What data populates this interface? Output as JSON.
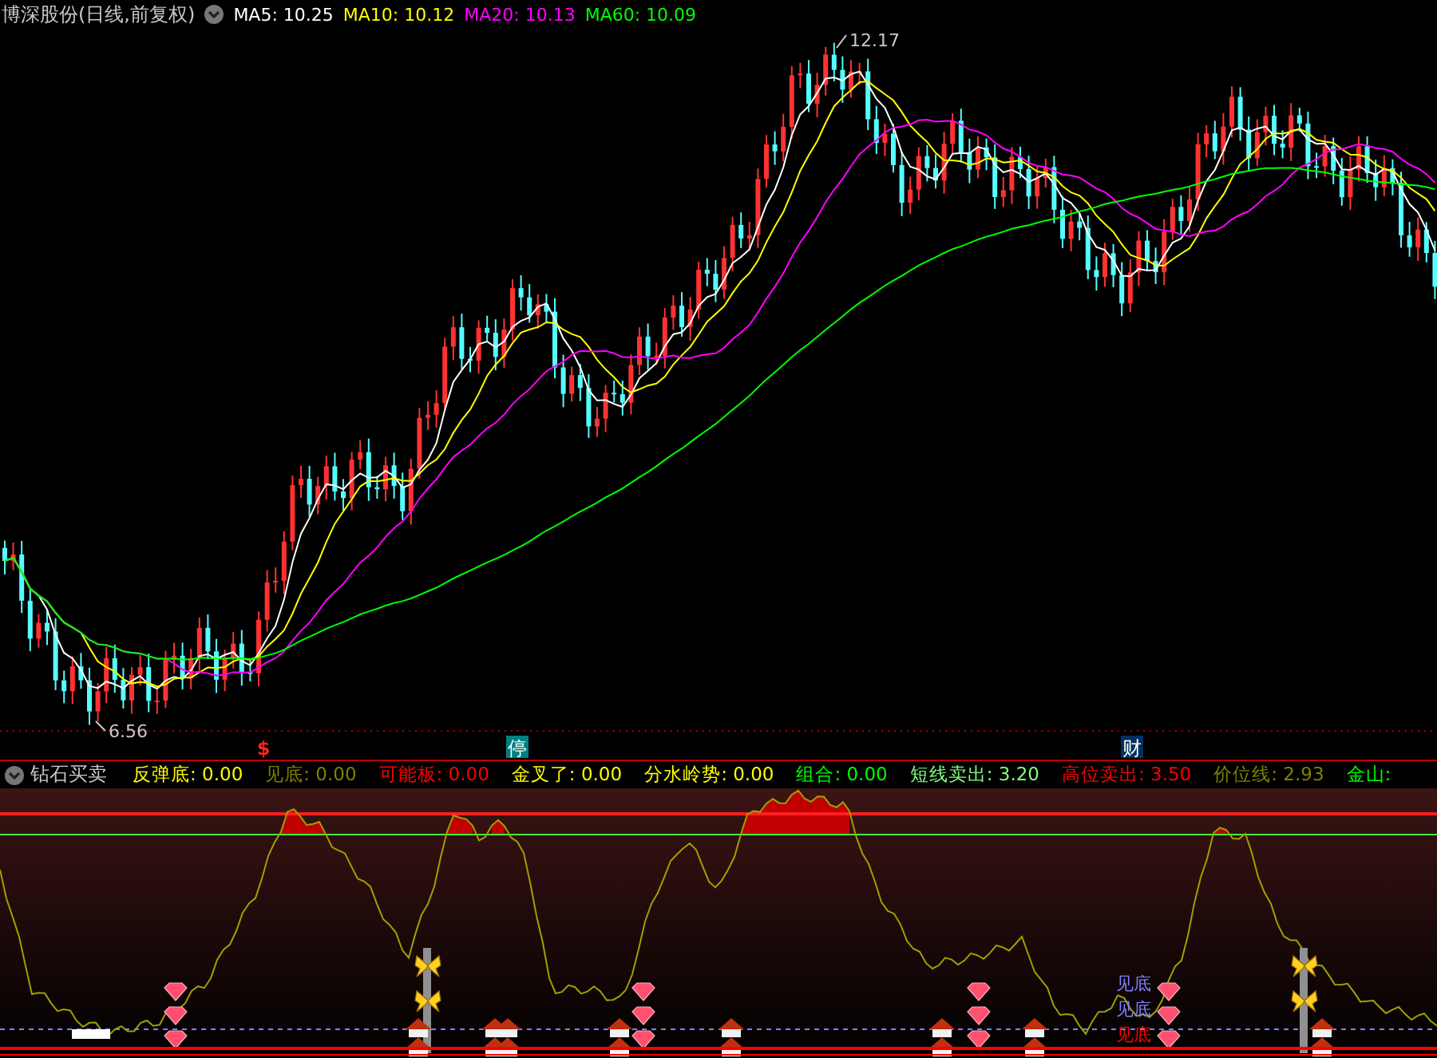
{
  "main_panel": {
    "title": "博深股份(日线,前复权)",
    "ma_labels": [
      {
        "text": "MA5: 10.25",
        "color": "#ffffff"
      },
      {
        "text": "MA10: 10.12",
        "color": "#ffff00"
      },
      {
        "text": "MA20: 10.13",
        "color": "#ff00ff"
      },
      {
        "text": "MA60: 10.09",
        "color": "#00ff00"
      }
    ],
    "high_label": "12.17",
    "low_label": "6.56"
  },
  "event_markers": [
    {
      "text": "$",
      "kind": "dollar"
    },
    {
      "text": "停",
      "kind": "halt"
    },
    {
      "text": "财",
      "kind": "finance"
    }
  ],
  "indicator_panel": {
    "title": "钻石买卖",
    "values": [
      {
        "text": "反弹底: 0.00",
        "color": "#ffff00"
      },
      {
        "text": "见底: 0.00",
        "color": "#808000"
      },
      {
        "text": "可能板: 0.00",
        "color": "#ff0000"
      },
      {
        "text": "金叉了: 0.00",
        "color": "#ffff00"
      },
      {
        "text": "分水岭势: 0.00",
        "color": "#ffff00"
      },
      {
        "text": "组合: 0.00",
        "color": "#00ff00"
      },
      {
        "text": "短线卖出: 3.20",
        "color": "#80ff80"
      },
      {
        "text": "高位卖出: 3.50",
        "color": "#ff0000"
      },
      {
        "text": "价位线: 2.93",
        "color": "#808000"
      },
      {
        "text": "金山:",
        "color": "#00ff00"
      }
    ],
    "signal_labels": [
      {
        "text": "见底",
        "color": "#8080ff"
      },
      {
        "text": "见底",
        "color": "#8080ff"
      },
      {
        "text": "见底",
        "color": "#ff0000"
      }
    ]
  }
}
